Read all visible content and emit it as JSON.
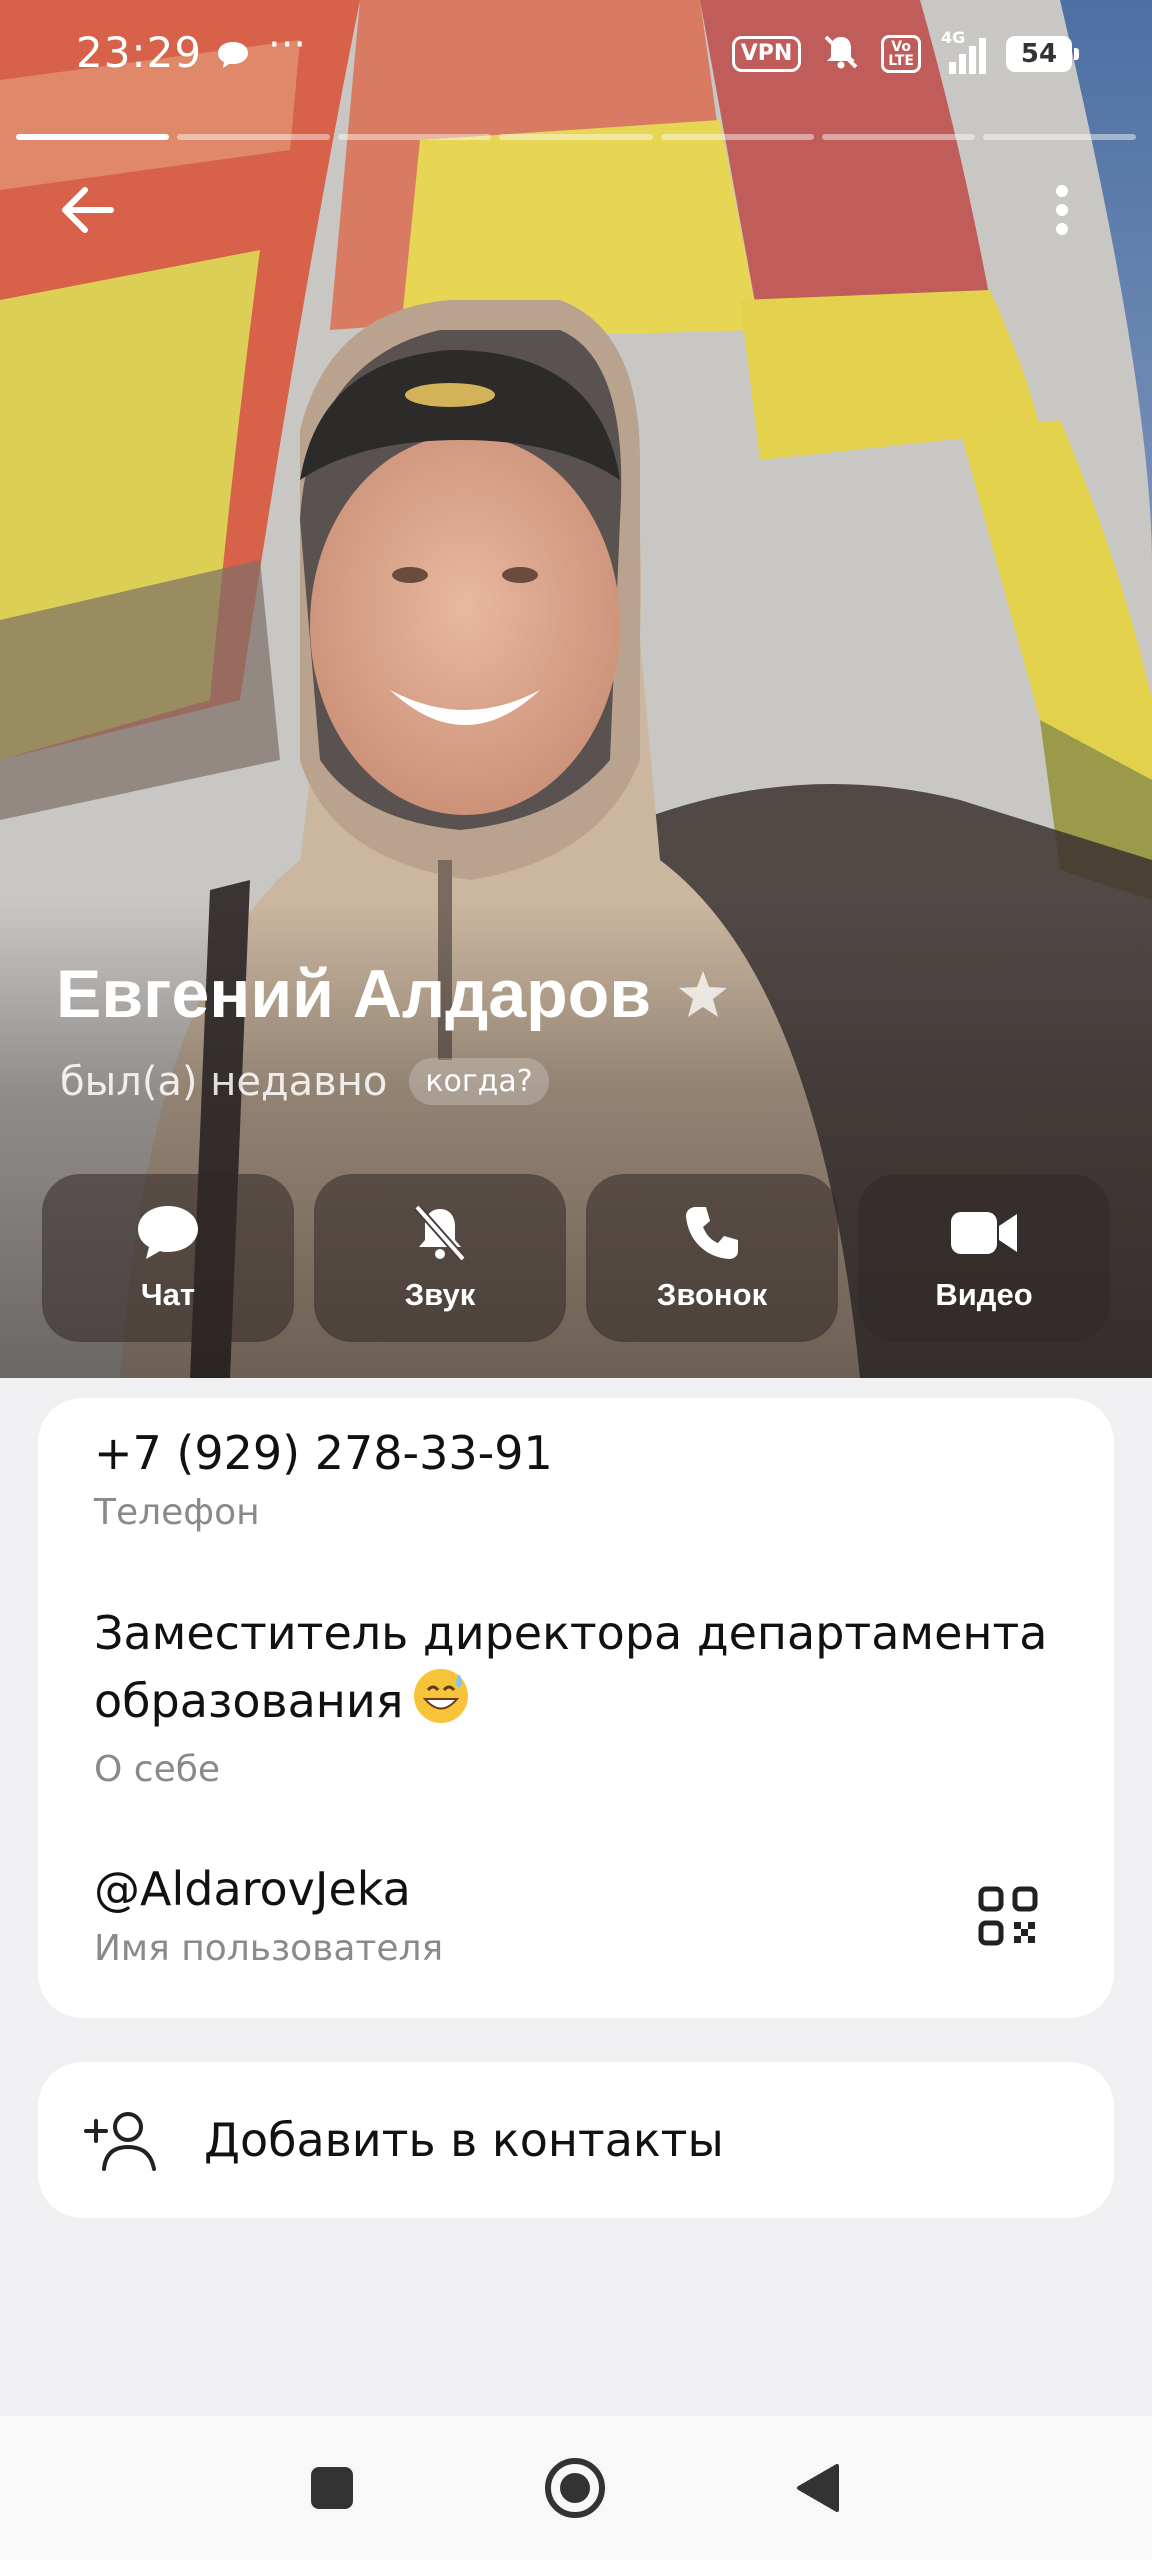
{
  "status_bar": {
    "time": "23:29",
    "dots": "···",
    "vpn": "VPN",
    "volte": "Vo\nLTE",
    "network": "4G",
    "battery": "54"
  },
  "stories": {
    "count": 7,
    "active_index": 0
  },
  "profile": {
    "name": "Евгений Алдаров",
    "last_seen": "был(а) недавно",
    "when_button": "когда?"
  },
  "actions": [
    {
      "label": "Чат",
      "icon": "chat-icon"
    },
    {
      "label": "Звук",
      "icon": "bell-muted-icon"
    },
    {
      "label": "Звонок",
      "icon": "phone-icon"
    },
    {
      "label": "Видео",
      "icon": "video-camera-icon"
    }
  ],
  "info": {
    "phone": {
      "value": "+7 (929) 278-33-91",
      "caption": "Телефон"
    },
    "bio": {
      "line1": "Заместитель директора департамента",
      "line2": "образования",
      "emoji": "grinning-sweat-emoji",
      "caption": "О себе"
    },
    "username": {
      "value": "@AldarovJeka",
      "caption": "Имя пользователя"
    }
  },
  "add_contact": {
    "label": "Добавить в контакты"
  },
  "colors": {
    "background": "#f0f0f3",
    "card": "#ffffff",
    "caption": "#8a8a8e",
    "action_button": "rgba(50,40,38,0.55)"
  }
}
